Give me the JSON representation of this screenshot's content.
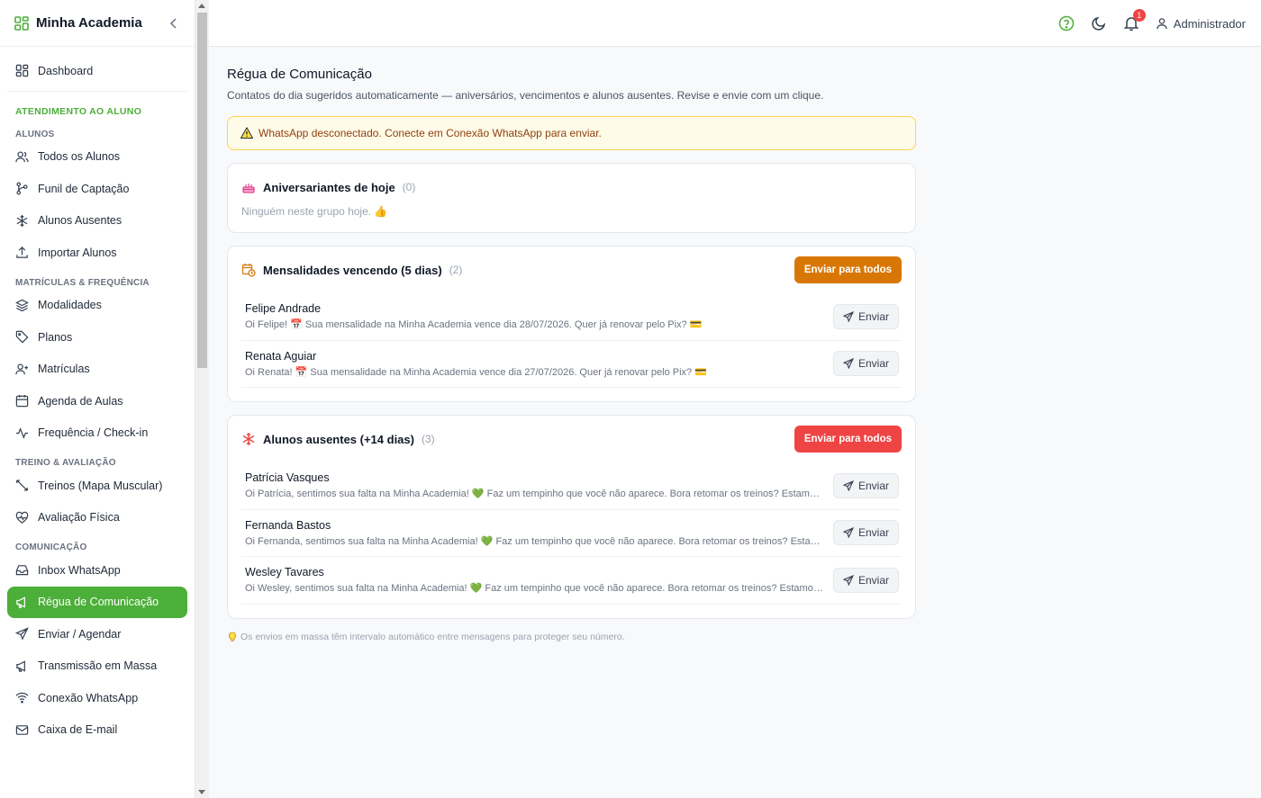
{
  "app": {
    "title": "Minha Academia"
  },
  "sidebar": {
    "dashboard": "Dashboard",
    "group_head": "ATENDIMENTO AO ALUNO",
    "sections": [
      {
        "title": "ALUNOS",
        "items": [
          {
            "label": "Todos os Alunos",
            "icon": "users-icon"
          },
          {
            "label": "Funil de Captação",
            "icon": "funnel-icon"
          },
          {
            "label": "Alunos Ausentes",
            "icon": "snowflake-icon"
          },
          {
            "label": "Importar Alunos",
            "icon": "upload-icon"
          }
        ]
      },
      {
        "title": "MATRÍCULAS & FREQUÊNCIA",
        "items": [
          {
            "label": "Modalidades",
            "icon": "layers-icon"
          },
          {
            "label": "Planos",
            "icon": "tag-icon"
          },
          {
            "label": "Matrículas",
            "icon": "user-plus-icon"
          },
          {
            "label": "Agenda de Aulas",
            "icon": "calendar-icon"
          },
          {
            "label": "Frequência / Check-in",
            "icon": "activity-icon"
          }
        ]
      },
      {
        "title": "TREINO & AVALIAÇÃO",
        "items": [
          {
            "label": "Treinos (Mapa Muscular)",
            "icon": "dumbbell-icon"
          },
          {
            "label": "Avaliação Física",
            "icon": "heart-pulse-icon"
          }
        ]
      },
      {
        "title": "COMUNICAÇÃO",
        "items": [
          {
            "label": "Inbox WhatsApp",
            "icon": "inbox-icon"
          },
          {
            "label": "Régua de Comunicação",
            "icon": "megaphone-icon",
            "active": true
          },
          {
            "label": "Enviar / Agendar",
            "icon": "send-icon"
          },
          {
            "label": "Transmissão em Massa",
            "icon": "megaphone-icon"
          },
          {
            "label": "Conexão WhatsApp",
            "icon": "wifi-icon"
          },
          {
            "label": "Caixa de E-mail",
            "icon": "mail-icon"
          }
        ]
      }
    ]
  },
  "topbar": {
    "notifications_count": "1",
    "user": "Administrador"
  },
  "page": {
    "title": "Régua de Comunicação",
    "subtitle": "Contatos do dia sugeridos automaticamente — aniversários, vencimentos e alunos ausentes. Revise e envie com um clique.",
    "alert": "WhatsApp desconectado. Conecte em Conexão WhatsApp para enviar.",
    "footnote": "Os envios em massa têm intervalo automático entre mensagens para proteger seu número."
  },
  "birthdays": {
    "title": "Aniversariantes de hoje",
    "count": "(0)",
    "empty": "Ninguém neste grupo hoje. 👍"
  },
  "dues": {
    "title": "Mensalidades vencendo (5 dias)",
    "count": "(2)",
    "send_all": "Enviar para todos",
    "rows": [
      {
        "name": "Felipe Andrade",
        "msg": "Oi Felipe! 📅 Sua mensalidade na Minha Academia vence dia 28/07/2026. Quer já renovar pelo Pix? 💳",
        "send": "Enviar"
      },
      {
        "name": "Renata Aguiar",
        "msg": "Oi Renata! 📅 Sua mensalidade na Minha Academia vence dia 27/07/2026. Quer já renovar pelo Pix? 💳",
        "send": "Enviar"
      }
    ]
  },
  "absent": {
    "title": "Alunos ausentes (+14 dias)",
    "count": "(3)",
    "send_all": "Enviar para todos",
    "rows": [
      {
        "name": "Patrícia Vasques",
        "msg": "Oi Patrícia, sentimos sua falta na Minha Academia! 💚 Faz um tempinho que você não aparece. Bora retomar os treinos? Estamos esperando você!",
        "send": "Enviar"
      },
      {
        "name": "Fernanda Bastos",
        "msg": "Oi Fernanda, sentimos sua falta na Minha Academia! 💚 Faz um tempinho que você não aparece. Bora retomar os treinos? Estamos esperando você!",
        "send": "Enviar"
      },
      {
        "name": "Wesley Tavares",
        "msg": "Oi Wesley, sentimos sua falta na Minha Academia! 💚 Faz um tempinho que você não aparece. Bora retomar os treinos? Estamos esperando você!",
        "send": "Enviar"
      }
    ]
  },
  "colors": {
    "brand": "#4caf39",
    "orange": "#d97706",
    "red": "#ef4444"
  }
}
